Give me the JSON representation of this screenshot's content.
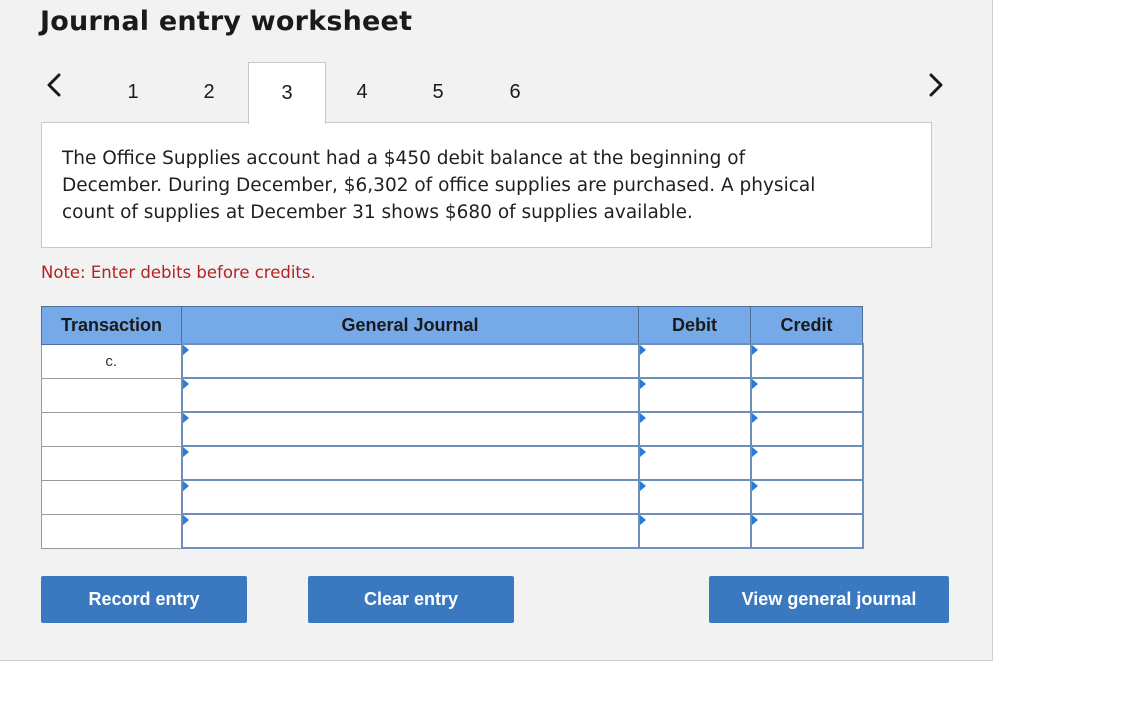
{
  "header": {
    "title": "Journal entry worksheet"
  },
  "nav": {
    "prev_icon": "chevron-left-icon",
    "next_icon": "chevron-right-icon",
    "tabs": [
      {
        "label": "1",
        "active": false
      },
      {
        "label": "2",
        "active": false
      },
      {
        "label": "3",
        "active": true
      },
      {
        "label": "4",
        "active": false
      },
      {
        "label": "5",
        "active": false
      },
      {
        "label": "6",
        "active": false
      }
    ]
  },
  "question": {
    "text": "The Office Supplies account had a $450 debit balance at the beginning of December. During December, $6,302 of office supplies are purchased. A physical count of supplies at December 31 shows $680 of supplies available."
  },
  "note": "Note: Enter debits before credits.",
  "journal": {
    "columns": [
      "Transaction",
      "General Journal",
      "Debit",
      "Credit"
    ],
    "rows": [
      {
        "transaction": "c.",
        "account": "",
        "debit": "",
        "credit": ""
      },
      {
        "transaction": "",
        "account": "",
        "debit": "",
        "credit": ""
      },
      {
        "transaction": "",
        "account": "",
        "debit": "",
        "credit": ""
      },
      {
        "transaction": "",
        "account": "",
        "debit": "",
        "credit": ""
      },
      {
        "transaction": "",
        "account": "",
        "debit": "",
        "credit": ""
      },
      {
        "transaction": "",
        "account": "",
        "debit": "",
        "credit": ""
      }
    ]
  },
  "buttons": {
    "record": "Record entry",
    "clear": "Clear entry",
    "view": "View general journal"
  },
  "colors": {
    "panel_bg": "#f2f2f2",
    "header_bg": "#76a9e8",
    "button_bg": "#3a78c0",
    "note_text": "#b22222"
  }
}
